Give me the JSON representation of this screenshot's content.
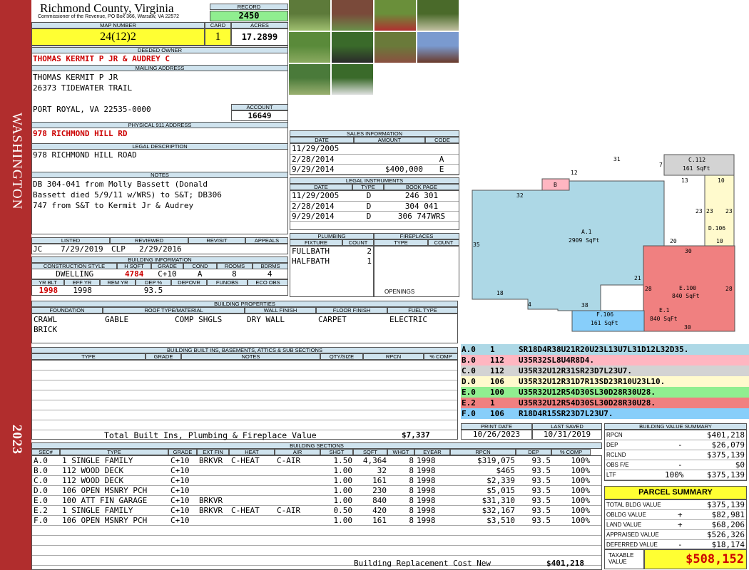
{
  "side": {
    "town": "WASHINGTON",
    "year": "2023"
  },
  "header": {
    "county": "Richmond County, Virginia",
    "commissioner": "Commissioner of the Revenue, PO Box 366, Warsaw, VA 22572",
    "record_label": "RECORD",
    "record": "2450",
    "map_label": "MAP NUMBER",
    "map": "24(12)2",
    "card_label": "CARD",
    "card": "1",
    "acres_label": "ACRES",
    "acres": "17.2899"
  },
  "owner": {
    "deeded_label": "DEEDED OWNER",
    "deeded": "THOMAS KERMIT P JR & AUDREY C",
    "mailing_label": "MAILING ADDRESS",
    "mail1": "THOMAS KERMIT P JR",
    "mail2": "26373 TIDEWATER TRAIL",
    "mail3": "PORT ROYAL, VA 22535-0000",
    "account_label": "ACCOUNT",
    "account": "16649",
    "physical_label": "PHYSICAL 911 ADDRESS",
    "physical": "978 RICHMOND HILL RD",
    "legal_label": "LEGAL DESCRIPTION",
    "legal": "978 RICHMOND HILL ROAD",
    "notes_label": "NOTES",
    "notes1": "DB 304-041 from Molly Bassett (Donald",
    "notes2": "Bassett died 5/9/11 w/WRS) to S&T; DB306",
    "notes3": "747 from S&T to Kermit Jr & Audrey"
  },
  "status": {
    "listed_label": "LISTED",
    "reviewed_label": "REVIEWED",
    "revisit_label": "REVISIT",
    "appeals_label": "APPEALS",
    "listed_by": "JC",
    "listed_date": "7/29/2019",
    "reviewed_by": "CLP",
    "reviewed_date": "2/29/2016"
  },
  "building_info": {
    "title": "BUILDING INFORMATION",
    "h": [
      "CONSTRUCTION STYLE",
      "H SQFT",
      "GRADE",
      "COND",
      "ROOMS",
      "BDRMS"
    ],
    "v": [
      "DWELLING",
      "4784",
      "C+10",
      "A",
      "8",
      "4"
    ],
    "h2": [
      "YR BLT",
      "EFF YR",
      "REM YR",
      "DEP %",
      "DEPOVR",
      "FUNOBS",
      "ECO OBS"
    ],
    "v2": [
      "1998",
      "1998",
      "",
      "93.5",
      "",
      "",
      ""
    ]
  },
  "sales": {
    "title": "SALES INFORMATION",
    "h": [
      "DATE",
      "AMOUNT",
      "CODE"
    ],
    "rows": [
      {
        "date": "11/29/2005",
        "amount": "",
        "code": ""
      },
      {
        "date": "2/28/2014",
        "amount": "",
        "code": "A"
      },
      {
        "date": "9/29/2014",
        "amount": "$400,000",
        "code": "E"
      }
    ]
  },
  "instruments": {
    "title": "LEGAL INSTRUMENTS",
    "h": [
      "DATE",
      "TYPE",
      "BOOK PAGE"
    ],
    "rows": [
      {
        "date": "11/29/2005",
        "type": "D",
        "book": "246 301"
      },
      {
        "date": "2/28/2014",
        "type": "D",
        "book": "304 041"
      },
      {
        "date": "9/29/2014",
        "type": "D",
        "book": "306 747WRS"
      }
    ]
  },
  "plumbing": {
    "title": "PLUMBING",
    "h": [
      "FIXTURE",
      "COUNT"
    ],
    "rows": [
      {
        "f": "FULLBATH",
        "c": "2"
      },
      {
        "f": "HALFBATH",
        "c": "1"
      }
    ]
  },
  "fireplaces": {
    "title": "FIREPLACES",
    "h": [
      "TYPE",
      "COUNT"
    ],
    "openings": "OPENINGS"
  },
  "properties": {
    "title": "BUILDING PROPERTIES",
    "h": [
      "FOUNDATION",
      "ROOF TYPE/MATERIAL",
      "WALL FINISH",
      "FLOOR FINISH",
      "FUEL TYPE"
    ],
    "foundation1": "CRAWL",
    "foundation2": "BRICK",
    "roof1": "GABLE",
    "roof2": "COMP SHGLS",
    "wall": "DRY WALL",
    "floor": "CARPET",
    "fuel": "ELECTRIC"
  },
  "builtins": {
    "title": "BUILDING BUILT INS, BASEMENTS, ATTICS & SUB SECTIONS",
    "h": [
      "TYPE",
      "GRADE",
      "NOTES",
      "QTY/SIZE",
      "RPCN",
      "% COMP"
    ],
    "total_label": "Total Built Ins, Plumbing & Fireplace Value",
    "total": "$7,337"
  },
  "sketch": {
    "labels": {
      "n31": "31",
      "n7": "7",
      "n12": "12",
      "n13": "13",
      "n10a": "10",
      "n32": "32",
      "n23a": "23",
      "n23b": "23",
      "n23c": "23",
      "n35": "35",
      "n20": "20",
      "n10b": "10",
      "n30a": "30",
      "n21": "21",
      "n28a": "28",
      "n28b": "28",
      "n18": "18",
      "n4": "4",
      "n38": "38",
      "n30b": "30",
      "b": "B",
      "c": "C.112",
      "c_sq": "161 SqFt",
      "a": "A.1",
      "a_sq": "2909 SqFt",
      "d": "D.106",
      "e100": "E.100",
      "e100_sq": "840 SqFt",
      "e1": "E.1",
      "e1_sq": "840 SqFt",
      "f": "F.106",
      "f_sq": "161 SqFt"
    },
    "colors": {
      "a": "#add8e6",
      "b": "#ffb6c1",
      "c": "#d3d3d3",
      "d": "#fffacd",
      "e": "#f08080",
      "f": "#87cefa"
    }
  },
  "vectors": [
    {
      "id": "A.0",
      "code": "1",
      "path": "SR18D4R38U21R20U23L13U7L31D12L32D35.",
      "color": "#add8e6"
    },
    {
      "id": "B.0",
      "code": "112",
      "path": "U35R32SL8U4R8D4.",
      "color": "#ffb6c1"
    },
    {
      "id": "C.0",
      "code": "112",
      "path": "U35R32U12R31SR23D7L23U7.",
      "color": "#d3d3d3"
    },
    {
      "id": "D.0",
      "code": "106",
      "path": "U35R32U12R31D7R13SD23R10U23L10.",
      "color": "#fffacd"
    },
    {
      "id": "E.0",
      "code": "100",
      "path": "U35R32U12R54D30SL30D28R30U28.",
      "color": "#90ee90"
    },
    {
      "id": "E.2",
      "code": "1",
      "path": "U35R32U12R54D30SL30D28R30U28.",
      "color": "#f08080"
    },
    {
      "id": "F.0",
      "code": "106",
      "path": "R18D4R15SR23D7L23U7.",
      "color": "#87cefa"
    }
  ],
  "dates": {
    "print_label": "PRINT DATE",
    "print": "10/26/2023",
    "saved_label": "LAST SAVED",
    "saved": "10/31/2019"
  },
  "value_summary": {
    "title": "BUILDING VALUE SUMMARY",
    "rows": [
      {
        "l": "RPCN",
        "s": "",
        "v": "$401,218"
      },
      {
        "l": "DEP",
        "s": "-",
        "v": "$26,079"
      },
      {
        "l": "RCLND",
        "s": "",
        "v": "$375,139"
      },
      {
        "l": "OBS F/E",
        "s": "-",
        "v": "$0"
      },
      {
        "l": "LTF",
        "pct": "100%",
        "s": "",
        "v": "$375,139"
      }
    ]
  },
  "parcel": {
    "title": "PARCEL SUMMARY",
    "rows": [
      {
        "l": "TOTAL BLDG VALUE",
        "s": "",
        "v": "$375,139"
      },
      {
        "l": "OBLDG VALUE",
        "s": "+",
        "v": "$82,981"
      },
      {
        "l": "LAND VALUE",
        "s": "+",
        "v": "$68,206"
      },
      {
        "l": "APPRAISED VALUE",
        "s": "",
        "v": "$526,326"
      },
      {
        "l": "DEFERRED VALUE",
        "s": "-",
        "v": "$18,174"
      }
    ],
    "taxable_label": "TAXABLE VALUE",
    "taxable": "$508,152"
  },
  "sections": {
    "title": "BUILDING SECTIONS",
    "h": [
      "SEC#",
      "TYPE",
      "GRADE",
      "EXT FIN",
      "HEAT",
      "AIR",
      "SHGT",
      "SQFT",
      "WHGT",
      "EYEAR",
      "RPCN",
      "DEP",
      "% COMP"
    ],
    "rows": [
      [
        "A.0",
        "1 SINGLE FAMILY",
        "C+10",
        "BRKVR",
        "C-HEAT",
        "C-AIR",
        "1.50",
        "4,364",
        "8",
        "1998",
        "$319,075",
        "93.5",
        "100%"
      ],
      [
        "B.0",
        "112 WOOD DECK",
        "C+10",
        "",
        "",
        "",
        "1.00",
        "32",
        "8",
        "1998",
        "$465",
        "93.5",
        "100%"
      ],
      [
        "C.0",
        "112 WOOD DECK",
        "C+10",
        "",
        "",
        "",
        "1.00",
        "161",
        "8",
        "1998",
        "$2,339",
        "93.5",
        "100%"
      ],
      [
        "D.0",
        "106 OPEN MSNRY PCH",
        "C+10",
        "",
        "",
        "",
        "1.00",
        "230",
        "8",
        "1998",
        "$5,015",
        "93.5",
        "100%"
      ],
      [
        "E.0",
        "100 ATT FIN GARAGE",
        "C+10",
        "BRKVR",
        "",
        "",
        "1.00",
        "840",
        "8",
        "1998",
        "$31,310",
        "93.5",
        "100%"
      ],
      [
        "E.2",
        "1 SINGLE FAMILY",
        "C+10",
        "BRKVR",
        "C-HEAT",
        "C-AIR",
        "0.50",
        "420",
        "8",
        "1998",
        "$32,167",
        "93.5",
        "100%"
      ],
      [
        "F.0",
        "106 OPEN MSNRY PCH",
        "C+10",
        "",
        "",
        "",
        "1.00",
        "161",
        "8",
        "1998",
        "$3,510",
        "93.5",
        "100%"
      ]
    ],
    "total_label": "Building Replacement Cost New",
    "total": "$401,218"
  },
  "photos": [
    {
      "c1": "#5d7a3a",
      "c2": "#9fbf70"
    },
    {
      "c1": "#7a4a3a",
      "c2": "#6a8f4a"
    },
    {
      "c1": "#6a8f3a",
      "c2": "#b03030"
    },
    {
      "c1": "#4a6a2a",
      "c2": "#c0c0a0"
    },
    {
      "c1": "#5a8a3a",
      "c2": "#8aaa60"
    },
    {
      "c1": "#3a6a2a",
      "c2": "#2a2a2a"
    },
    {
      "c1": "#6a7a3a",
      "c2": "#8a5040"
    },
    {
      "c1": "#7a9acf",
      "c2": "#6a3a2a"
    },
    {
      "c1": "#4a7a3a",
      "c2": "#9ab070"
    },
    {
      "c1": "#3a6a2a",
      "c2": "#e0e0e0"
    }
  ]
}
